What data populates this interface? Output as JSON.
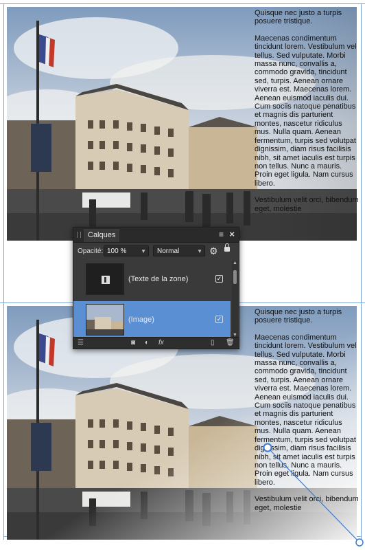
{
  "colors": {
    "accent_selection": "#5b8fd4",
    "panel_background": "#3a3a3a",
    "guide_line": "#7aa3d8"
  },
  "text_frame": {
    "paragraph1": "Quisque nec justo a turpis posuere tristique.",
    "paragraph2": "Maecenas condimentum tincidunt lorem. Vestibulum vel tellus. Sed vulputate. Morbi massa nunc, convallis a, commodo gravida, tincidunt sed, turpis. Aenean ornare viverra est. Maecenas lorem. Aenean euismod iaculis dui. Cum sociis natoque penatibus et magnis dis parturient montes, nascetur ridiculus mus. Nulla quam. Aenean fermentum, turpis sed volutpat dignissim, diam risus facilisis nibh, sit amet iaculis est turpis non tellus. Nunc a mauris. Proin eget ligula. Nam cursus libero.",
    "paragraph3": "Vestibulum velit orci, bibendum eget, molestie"
  },
  "layers_panel": {
    "tab_label": "Calques",
    "menu_icon": "hamburger-menu-icon",
    "close_label": "×",
    "opacity_label": "Opacité:",
    "opacity_value": "100 %",
    "blend_mode": "Normal",
    "layers": [
      {
        "name": "(Texte de la zone)",
        "visible": true,
        "selected": false,
        "icon": "text-frame-icon"
      },
      {
        "name": "(Image)",
        "visible": true,
        "selected": true,
        "icon": "image-thumbnail"
      }
    ],
    "bottom_icons": [
      "layers-stack-icon",
      "mask-icon",
      "adjustment-icon",
      "fx-icon",
      "new-layer-icon",
      "trash-icon"
    ],
    "fx_label": "fx"
  }
}
